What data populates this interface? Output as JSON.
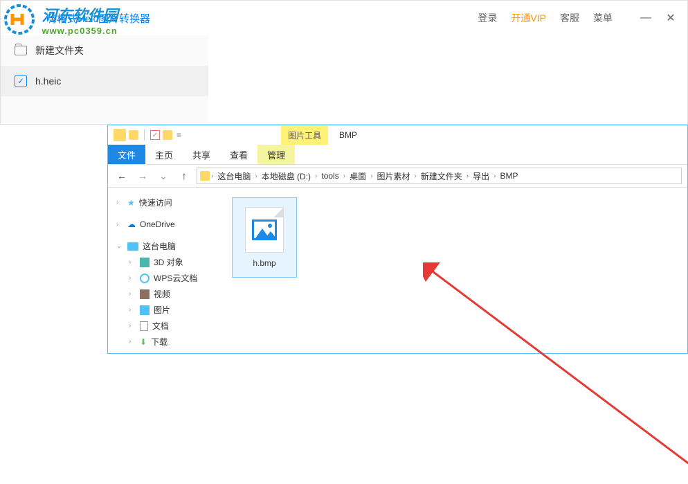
{
  "watermark": {
    "cn": "河东软件园",
    "url": "www.pc0359.cn"
  },
  "app": {
    "title": "嗨格式Heic图片转换器",
    "login": "登录",
    "vip": "开通VIP",
    "service": "客服",
    "menu": "菜单",
    "sidebar": {
      "newFolder": "新建文件夹",
      "file": "h.heic"
    }
  },
  "explorer": {
    "picTools": "图片工具",
    "winTitle": "BMP",
    "tabs": {
      "file": "文件",
      "home": "主页",
      "share": "共享",
      "view": "查看",
      "manage": "管理"
    },
    "breadcrumb": [
      "这台电脑",
      "本地磁盘 (D:)",
      "tools",
      "桌面",
      "图片素材",
      "新建文件夹",
      "导出",
      "BMP"
    ],
    "nav": {
      "quickAccess": "快速访问",
      "oneDrive": "OneDrive",
      "thisPC": "这台电脑",
      "objects3d": "3D 对象",
      "wps": "WPS云文档",
      "video": "视频",
      "pictures": "图片",
      "documents": "文档",
      "downloads": "下载"
    },
    "file": {
      "name": "h.bmp"
    }
  }
}
